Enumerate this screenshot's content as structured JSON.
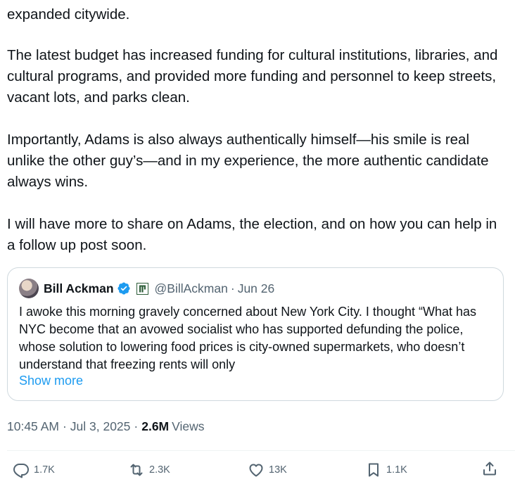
{
  "tweet": {
    "paragraphs": [
      "expanded citywide.",
      "The latest budget has increased funding for cultural institutions, libraries, and cultural programs, and provided more funding and personnel to keep streets, vacant lots, and parks clean.",
      "Importantly, Adams is also always authentically himself—his smile is real unlike the other guy’s—and in my experience, the more authentic candidate always wins.",
      "I will have more to share on Adams, the election, and on how you can help in a follow up post soon."
    ]
  },
  "quote": {
    "name": "Bill Ackman",
    "handle": "@BillAckman",
    "separator": "·",
    "date": "Jun 26",
    "text": "I awoke this morning gravely concerned about New York City. I thought “What has NYC become that an avowed socialist who has supported defunding the police, whose solution to lowering food prices is city-owned supermarkets, who doesn’t understand that freezing rents will only",
    "show_more": "Show more",
    "verified_color": "#1d9bf0"
  },
  "meta": {
    "time": "10:45 AM",
    "sep1": "·",
    "date": "Jul 3, 2025",
    "sep2": "·",
    "views_count": "2.6M",
    "views_label": "Views"
  },
  "actions": {
    "reply_count": "1.7K",
    "retweet_count": "2.3K",
    "like_count": "13K",
    "bookmark_count": "1.1K",
    "icons": [
      "reply-icon",
      "retweet-icon",
      "heart-icon",
      "bookmark-icon",
      "share-icon"
    ]
  },
  "colors": {
    "text": "#0f1419",
    "secondary": "#536471",
    "link": "#1d9bf0",
    "border": "#cfd9de"
  }
}
